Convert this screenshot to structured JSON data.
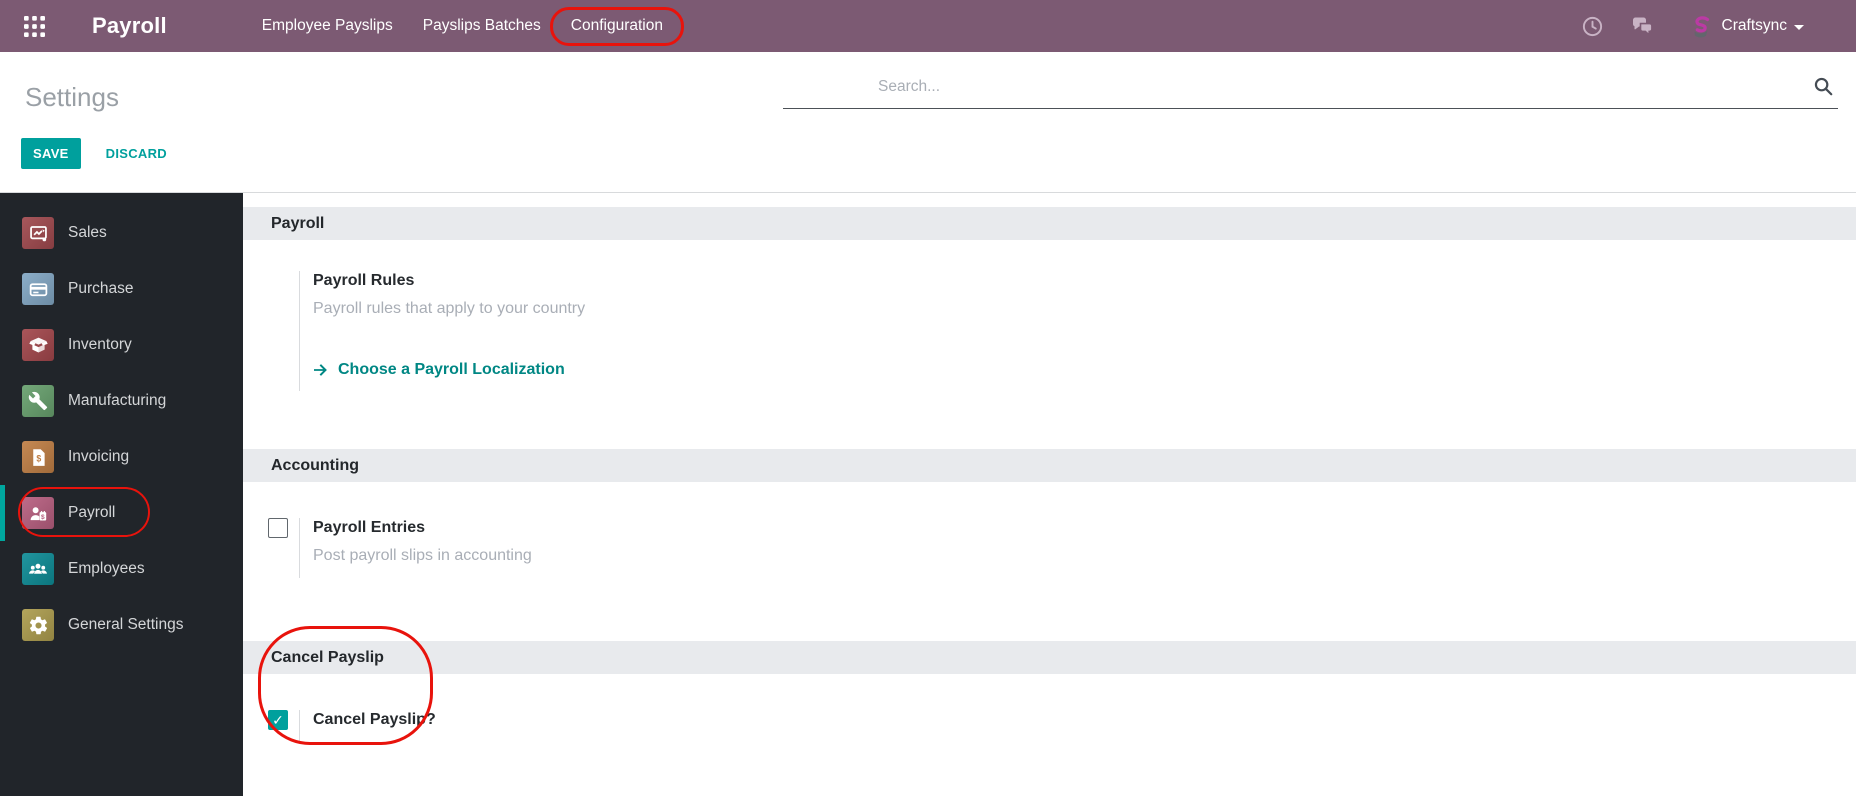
{
  "nav": {
    "app_title": "Payroll",
    "menu": [
      {
        "label": "Employee Payslips",
        "highlighted": false
      },
      {
        "label": "Payslips Batches",
        "highlighted": false
      },
      {
        "label": "Configuration",
        "highlighted": true
      }
    ],
    "user_name": "Craftsync"
  },
  "control_panel": {
    "title": "Settings",
    "save_label": "SAVE",
    "discard_label": "DISCARD",
    "search_placeholder": "Search..."
  },
  "sidebar": {
    "items": [
      {
        "label": "Sales",
        "color": "#a0494e",
        "active": false
      },
      {
        "label": "Purchase",
        "color": "#82a7c4",
        "active": false
      },
      {
        "label": "Inventory",
        "color": "#a3474c",
        "active": false
      },
      {
        "label": "Manufacturing",
        "color": "#68a16e",
        "active": false
      },
      {
        "label": "Invoicing",
        "color": "#c07f45",
        "active": false
      },
      {
        "label": "Payroll",
        "color": "#b85f80",
        "active": true
      },
      {
        "label": "Employees",
        "color": "#0e8c96",
        "active": false
      },
      {
        "label": "General Settings",
        "color": "#ad9d4e",
        "active": false
      }
    ]
  },
  "settings": {
    "sections": [
      {
        "title": "Payroll",
        "rows": [
          {
            "label": "Payroll Rules",
            "description": "Payroll rules that apply to your country",
            "link_label": "Choose a Payroll Localization"
          }
        ]
      },
      {
        "title": "Accounting",
        "rows": [
          {
            "label": "Payroll Entries",
            "description": "Post payroll slips in accounting",
            "state": "unchecked"
          }
        ]
      },
      {
        "title": "Cancel Payslip",
        "rows": [
          {
            "label": "Cancel Payslip?",
            "state": "checked"
          }
        ]
      }
    ]
  },
  "annotations": [
    "configuration-menu-item",
    "payroll-sidebar-item",
    "cancel-payslip-section"
  ],
  "colors": {
    "nav_purple": "#7c5a73",
    "accent_teal": "#00a09d",
    "link_teal": "#008784",
    "annotation_red": "#e8130c",
    "sidebar_bg": "#21252a",
    "section_band_gray": "#e8eaed"
  }
}
